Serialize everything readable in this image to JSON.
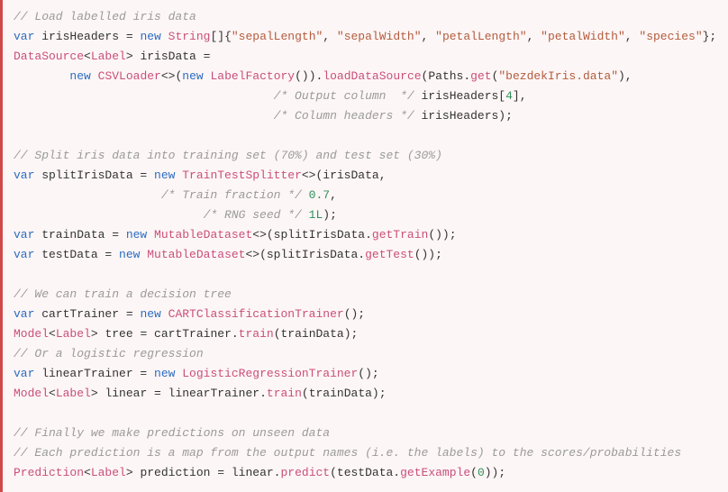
{
  "code": {
    "lines": [
      [
        {
          "cls": "tok-comment",
          "text": "// Load labelled iris data"
        }
      ],
      [
        {
          "cls": "tok-keyword",
          "text": "var"
        },
        {
          "cls": "tok-plain",
          "text": " irisHeaders = "
        },
        {
          "cls": "tok-keyword",
          "text": "new"
        },
        {
          "cls": "tok-plain",
          "text": " "
        },
        {
          "cls": "tok-type",
          "text": "String"
        },
        {
          "cls": "tok-plain",
          "text": "[]{"
        },
        {
          "cls": "tok-string",
          "text": "\"sepalLength\""
        },
        {
          "cls": "tok-plain",
          "text": ", "
        },
        {
          "cls": "tok-string",
          "text": "\"sepalWidth\""
        },
        {
          "cls": "tok-plain",
          "text": ", "
        },
        {
          "cls": "tok-string",
          "text": "\"petalLength\""
        },
        {
          "cls": "tok-plain",
          "text": ", "
        },
        {
          "cls": "tok-string",
          "text": "\"petalWidth\""
        },
        {
          "cls": "tok-plain",
          "text": ", "
        },
        {
          "cls": "tok-string",
          "text": "\"species\""
        },
        {
          "cls": "tok-plain",
          "text": "};"
        }
      ],
      [
        {
          "cls": "tok-type",
          "text": "DataSource"
        },
        {
          "cls": "tok-plain",
          "text": "<"
        },
        {
          "cls": "tok-type",
          "text": "Label"
        },
        {
          "cls": "tok-plain",
          "text": "> irisData ="
        }
      ],
      [
        {
          "cls": "tok-plain",
          "text": "        "
        },
        {
          "cls": "tok-keyword",
          "text": "new"
        },
        {
          "cls": "tok-plain",
          "text": " "
        },
        {
          "cls": "tok-type",
          "text": "CSVLoader"
        },
        {
          "cls": "tok-plain",
          "text": "<>("
        },
        {
          "cls": "tok-keyword",
          "text": "new"
        },
        {
          "cls": "tok-plain",
          "text": " "
        },
        {
          "cls": "tok-type",
          "text": "LabelFactory"
        },
        {
          "cls": "tok-plain",
          "text": "())."
        },
        {
          "cls": "tok-type",
          "text": "loadDataSource"
        },
        {
          "cls": "tok-plain",
          "text": "(Paths."
        },
        {
          "cls": "tok-type",
          "text": "get"
        },
        {
          "cls": "tok-plain",
          "text": "("
        },
        {
          "cls": "tok-string",
          "text": "\"bezdekIris.data\""
        },
        {
          "cls": "tok-plain",
          "text": "),"
        }
      ],
      [
        {
          "cls": "tok-plain",
          "text": "                                     "
        },
        {
          "cls": "tok-comment",
          "text": "/* Output column  */"
        },
        {
          "cls": "tok-plain",
          "text": " irisHeaders["
        },
        {
          "cls": "tok-number",
          "text": "4"
        },
        {
          "cls": "tok-plain",
          "text": "],"
        }
      ],
      [
        {
          "cls": "tok-plain",
          "text": "                                     "
        },
        {
          "cls": "tok-comment",
          "text": "/* Column headers */"
        },
        {
          "cls": "tok-plain",
          "text": " irisHeaders);"
        }
      ],
      [
        {
          "cls": "tok-plain",
          "text": ""
        }
      ],
      [
        {
          "cls": "tok-comment",
          "text": "// Split iris data into training set (70%) and test set (30%)"
        }
      ],
      [
        {
          "cls": "tok-keyword",
          "text": "var"
        },
        {
          "cls": "tok-plain",
          "text": " splitIrisData = "
        },
        {
          "cls": "tok-keyword",
          "text": "new"
        },
        {
          "cls": "tok-plain",
          "text": " "
        },
        {
          "cls": "tok-type",
          "text": "TrainTestSplitter"
        },
        {
          "cls": "tok-plain",
          "text": "<>(irisData,"
        }
      ],
      [
        {
          "cls": "tok-plain",
          "text": "                     "
        },
        {
          "cls": "tok-comment",
          "text": "/* Train fraction */"
        },
        {
          "cls": "tok-plain",
          "text": " "
        },
        {
          "cls": "tok-number",
          "text": "0.7"
        },
        {
          "cls": "tok-plain",
          "text": ","
        }
      ],
      [
        {
          "cls": "tok-plain",
          "text": "                           "
        },
        {
          "cls": "tok-comment",
          "text": "/* RNG seed */"
        },
        {
          "cls": "tok-plain",
          "text": " "
        },
        {
          "cls": "tok-number",
          "text": "1L"
        },
        {
          "cls": "tok-plain",
          "text": ");"
        }
      ],
      [
        {
          "cls": "tok-keyword",
          "text": "var"
        },
        {
          "cls": "tok-plain",
          "text": " trainData = "
        },
        {
          "cls": "tok-keyword",
          "text": "new"
        },
        {
          "cls": "tok-plain",
          "text": " "
        },
        {
          "cls": "tok-type",
          "text": "MutableDataset"
        },
        {
          "cls": "tok-plain",
          "text": "<>(splitIrisData."
        },
        {
          "cls": "tok-type",
          "text": "getTrain"
        },
        {
          "cls": "tok-plain",
          "text": "());"
        }
      ],
      [
        {
          "cls": "tok-keyword",
          "text": "var"
        },
        {
          "cls": "tok-plain",
          "text": " testData = "
        },
        {
          "cls": "tok-keyword",
          "text": "new"
        },
        {
          "cls": "tok-plain",
          "text": " "
        },
        {
          "cls": "tok-type",
          "text": "MutableDataset"
        },
        {
          "cls": "tok-plain",
          "text": "<>(splitIrisData."
        },
        {
          "cls": "tok-type",
          "text": "getTest"
        },
        {
          "cls": "tok-plain",
          "text": "());"
        }
      ],
      [
        {
          "cls": "tok-plain",
          "text": ""
        }
      ],
      [
        {
          "cls": "tok-comment",
          "text": "// We can train a decision tree"
        }
      ],
      [
        {
          "cls": "tok-keyword",
          "text": "var"
        },
        {
          "cls": "tok-plain",
          "text": " cartTrainer = "
        },
        {
          "cls": "tok-keyword",
          "text": "new"
        },
        {
          "cls": "tok-plain",
          "text": " "
        },
        {
          "cls": "tok-type",
          "text": "CARTClassificationTrainer"
        },
        {
          "cls": "tok-plain",
          "text": "();"
        }
      ],
      [
        {
          "cls": "tok-type",
          "text": "Model"
        },
        {
          "cls": "tok-plain",
          "text": "<"
        },
        {
          "cls": "tok-type",
          "text": "Label"
        },
        {
          "cls": "tok-plain",
          "text": "> tree = cartTrainer."
        },
        {
          "cls": "tok-type",
          "text": "train"
        },
        {
          "cls": "tok-plain",
          "text": "(trainData);"
        }
      ],
      [
        {
          "cls": "tok-comment",
          "text": "// Or a logistic regression"
        }
      ],
      [
        {
          "cls": "tok-keyword",
          "text": "var"
        },
        {
          "cls": "tok-plain",
          "text": " linearTrainer = "
        },
        {
          "cls": "tok-keyword",
          "text": "new"
        },
        {
          "cls": "tok-plain",
          "text": " "
        },
        {
          "cls": "tok-type",
          "text": "LogisticRegressionTrainer"
        },
        {
          "cls": "tok-plain",
          "text": "();"
        }
      ],
      [
        {
          "cls": "tok-type",
          "text": "Model"
        },
        {
          "cls": "tok-plain",
          "text": "<"
        },
        {
          "cls": "tok-type",
          "text": "Label"
        },
        {
          "cls": "tok-plain",
          "text": "> linear = linearTrainer."
        },
        {
          "cls": "tok-type",
          "text": "train"
        },
        {
          "cls": "tok-plain",
          "text": "(trainData);"
        }
      ],
      [
        {
          "cls": "tok-plain",
          "text": ""
        }
      ],
      [
        {
          "cls": "tok-comment",
          "text": "// Finally we make predictions on unseen data"
        }
      ],
      [
        {
          "cls": "tok-comment",
          "text": "// Each prediction is a map from the output names (i.e. the labels) to the scores/probabilities"
        }
      ],
      [
        {
          "cls": "tok-type",
          "text": "Prediction"
        },
        {
          "cls": "tok-plain",
          "text": "<"
        },
        {
          "cls": "tok-type",
          "text": "Label"
        },
        {
          "cls": "tok-plain",
          "text": "> prediction = linear."
        },
        {
          "cls": "tok-type",
          "text": "predict"
        },
        {
          "cls": "tok-plain",
          "text": "(testData."
        },
        {
          "cls": "tok-type",
          "text": "getExample"
        },
        {
          "cls": "tok-plain",
          "text": "("
        },
        {
          "cls": "tok-number",
          "text": "0"
        },
        {
          "cls": "tok-plain",
          "text": "));"
        }
      ]
    ]
  }
}
